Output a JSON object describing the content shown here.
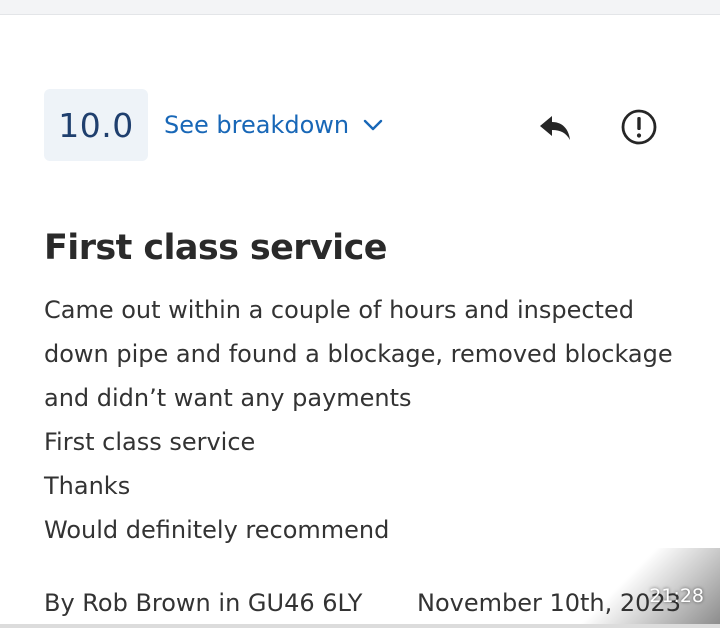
{
  "review": {
    "score": "10.0",
    "breakdown_label": "See breakdown",
    "title": "First class service",
    "body_lines": [
      "Came out within a couple of hours and inspected",
      "down pipe and found a blockage, removed blockage",
      "and didn’t want any payments",
      "First class service",
      "Thanks",
      "Would definitely recommend"
    ],
    "author_line": "By Rob  Brown in GU46 6LY",
    "date": "November 10th, 2023"
  },
  "overlay": {
    "time": "21:28"
  },
  "icons": {
    "breakdown_chevron": "chevron-down-icon",
    "reply": "reply-icon",
    "report": "report-icon"
  },
  "colors": {
    "score_bg": "#eef3f8",
    "score_text": "#1f3f6e",
    "link": "#1867b7"
  }
}
